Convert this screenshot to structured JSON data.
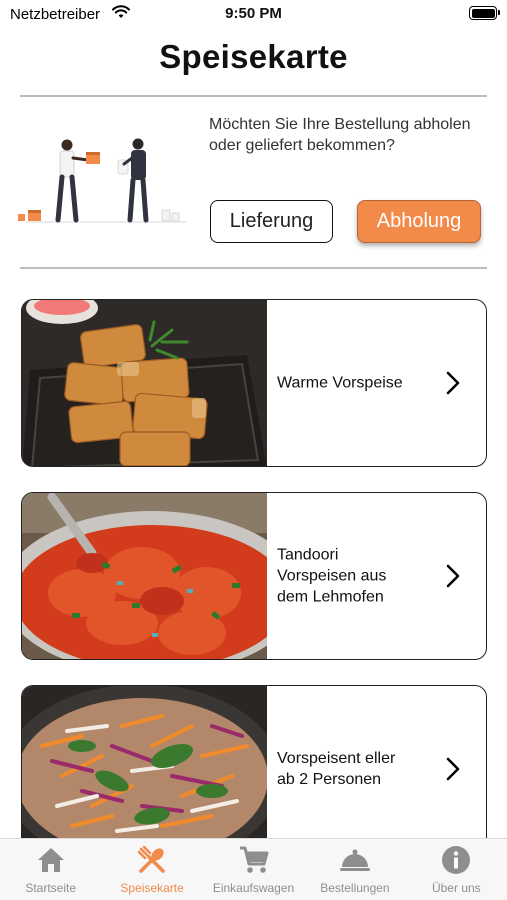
{
  "status_bar": {
    "carrier": "Netzbetreiber",
    "time": "9:50 PM"
  },
  "header": {
    "title": "Speisekarte"
  },
  "delivery": {
    "question": "Möchten Sie Ihre Bestellung abholen oder geliefert bekommen?",
    "delivery_label": "Lieferung",
    "pickup_label": "Abholung",
    "selected": "Abholung"
  },
  "categories": [
    {
      "label": "Warme Vorspeise",
      "image": "fried-appetizer-image"
    },
    {
      "label": "Tandoori Vorspeisen aus dem Lehmofen",
      "image": "tandoori-curry-image"
    },
    {
      "label": "Vorspeisent eller ab 2 Personen",
      "image": "vegetable-platter-image"
    }
  ],
  "tabs": [
    {
      "label": "Startseite",
      "icon": "home-icon",
      "active": false
    },
    {
      "label": "Speisekarte",
      "icon": "utensils-icon",
      "active": true
    },
    {
      "label": "Einkaufswagen",
      "icon": "cart-icon",
      "active": false
    },
    {
      "label": "Bestellungen",
      "icon": "cloche-icon",
      "active": false
    },
    {
      "label": "Über uns",
      "icon": "info-icon",
      "active": false
    }
  ],
  "colors": {
    "accent": "#f28a4a",
    "tab_inactive": "#8e8e8e"
  }
}
